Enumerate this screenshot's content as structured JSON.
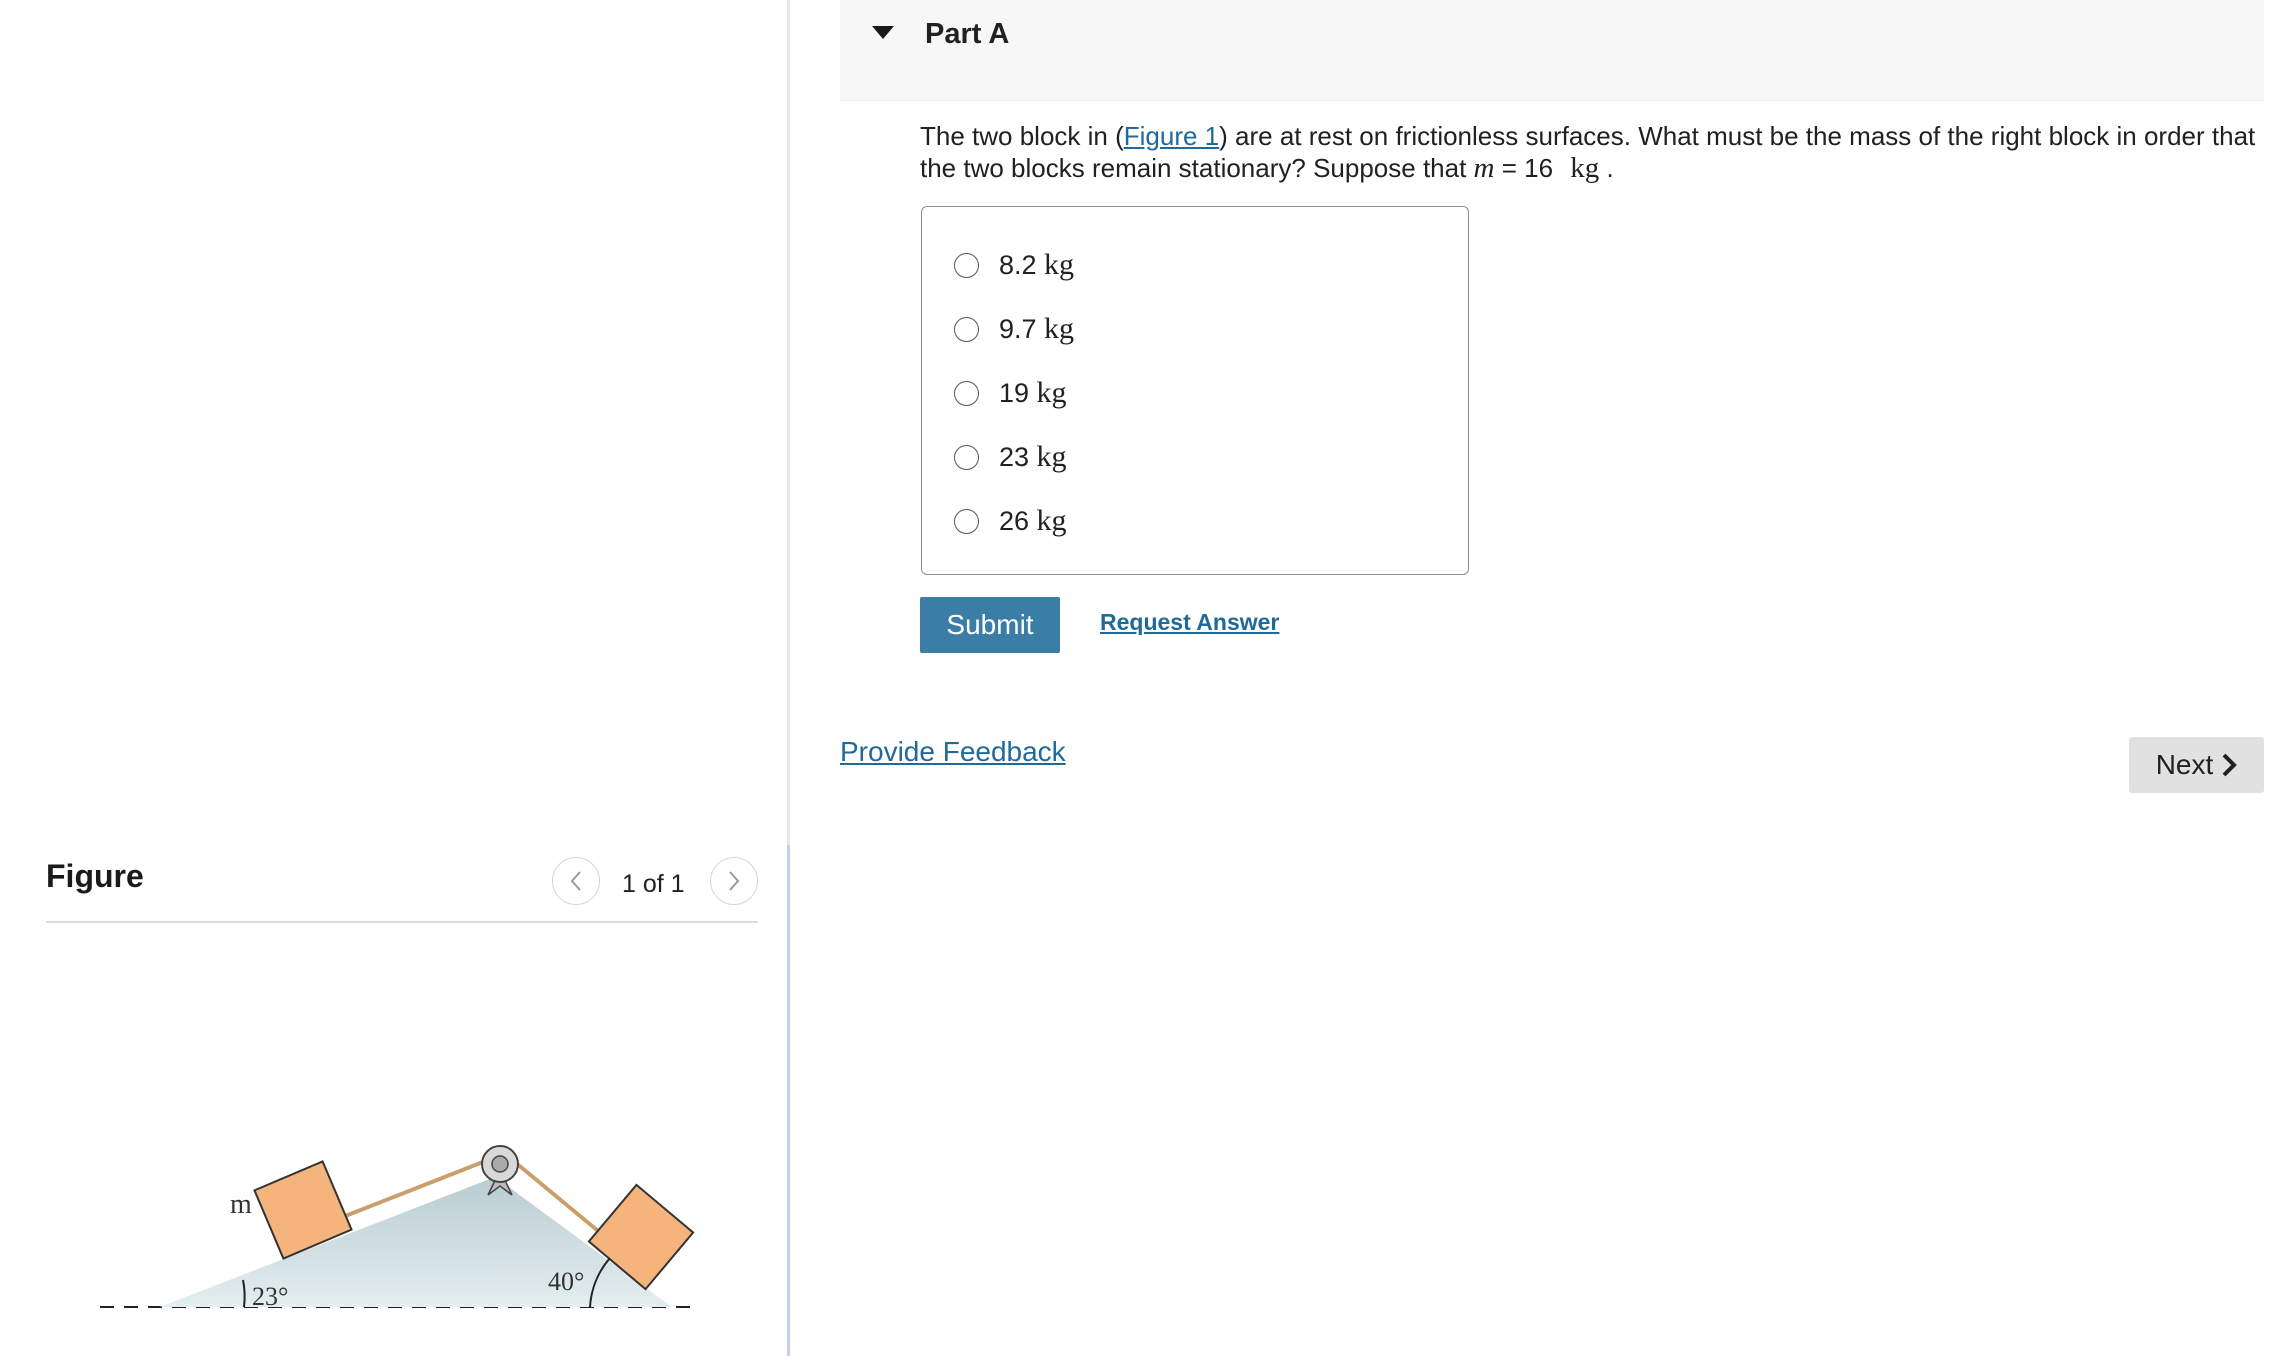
{
  "part": {
    "title": "Part A"
  },
  "question": {
    "text_before": "The two block in (",
    "figure_link": "Figure 1",
    "text_after": ") are at rest on frictionless surfaces. What must be the mass of the right block in order that the two blocks remain stationary? Suppose that ",
    "variable": "m",
    "equals": " = 16 ",
    "unit": "kg",
    "end": " ."
  },
  "choices": [
    {
      "value": "8.2",
      "unit": "kg"
    },
    {
      "value": "9.7",
      "unit": "kg"
    },
    {
      "value": "19",
      "unit": "kg"
    },
    {
      "value": "23",
      "unit": "kg"
    },
    {
      "value": "26",
      "unit": "kg"
    }
  ],
  "actions": {
    "submit_label": "Submit",
    "request_answer_label": "Request Answer",
    "provide_feedback_label": "Provide Feedback",
    "next_label": "Next"
  },
  "figure_panel": {
    "title": "Figure",
    "counter": "1 of 1",
    "block_label": "m",
    "left_angle": "23°",
    "right_angle": "40°"
  },
  "colors": {
    "link": "#1f6a9a",
    "submit_bg": "#3a7ea6",
    "block_fill": "#f5b47c",
    "rope": "#c9a06a",
    "incline": "#c5d4d8"
  },
  "icons": {
    "part_toggle": "caret-down-icon",
    "prev": "chevron-left-icon",
    "next_figure": "chevron-right-icon",
    "next_button": "chevron-right-icon"
  }
}
